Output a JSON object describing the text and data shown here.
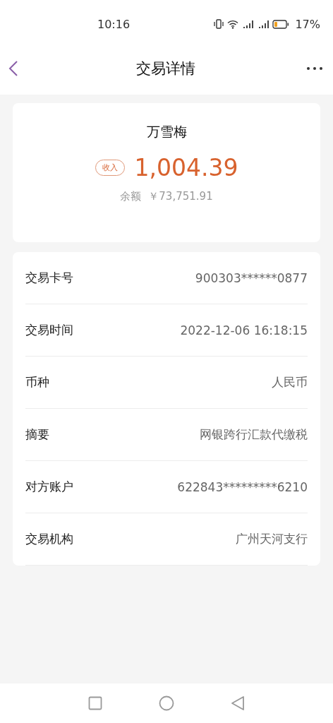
{
  "status_bar": {
    "time": "10:16",
    "battery": "17%"
  },
  "nav": {
    "title": "交易详情"
  },
  "summary": {
    "name": "万雪梅",
    "badge": "收入",
    "amount": "1,004.39",
    "balance_label": "余额",
    "balance": "￥73,751.91"
  },
  "details": [
    {
      "label": "交易卡号",
      "value": "900303******0877"
    },
    {
      "label": "交易时间",
      "value": "2022-12-06 16:18:15"
    },
    {
      "label": "币种",
      "value": "人民币"
    },
    {
      "label": "摘要",
      "value": "网银跨行汇款代缴税"
    },
    {
      "label": "对方账户",
      "value": "622843*********6210"
    },
    {
      "label": "交易机构",
      "value": "广州天河支行"
    }
  ]
}
